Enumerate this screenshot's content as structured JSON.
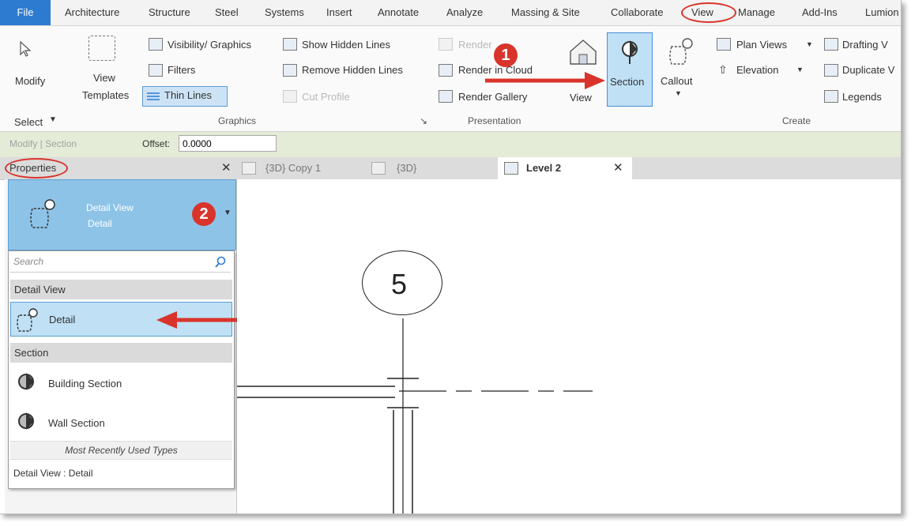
{
  "menu": {
    "tabs": [
      "File",
      "Architecture",
      "Structure",
      "Steel",
      "Systems",
      "Insert",
      "Annotate",
      "Analyze",
      "Massing & Site",
      "Collaborate",
      "View",
      "Manage",
      "Add-Ins",
      "Lumion"
    ]
  },
  "ribbon": {
    "modify": "Modify",
    "select": "Select",
    "view_templates_1": "View",
    "view_templates_2": "Templates",
    "visibility_graphics": "Visibility/ Graphics",
    "filters": "Filters",
    "thin_lines": "Thin Lines",
    "show_hidden_lines": "Show Hidden Lines",
    "remove_hidden_lines": "Remove Hidden Lines",
    "cut_profile": "Cut Profile",
    "render": "Render",
    "render_in_cloud": "Render in Cloud",
    "render_gallery": "Render Gallery",
    "view_3d": "View",
    "section": "Section",
    "callout": "Callout",
    "plan_views": "Plan Views",
    "elevation": "Elevation",
    "drafting_view": "Drafting V",
    "duplicate_view": "Duplicate V",
    "legends": "Legends",
    "groups": {
      "graphics": "Graphics",
      "presentation": "Presentation",
      "create": "Create"
    }
  },
  "options_bar": {
    "context": "Modify | Section",
    "offset_label": "Offset:",
    "offset_value": "0.0000"
  },
  "properties": {
    "title": "Properties",
    "type_family": "Detail View",
    "type_name": "Detail"
  },
  "view_tabs": [
    "{3D} Copy 1",
    "{3D}",
    "Level 2"
  ],
  "type_selector": {
    "search_placeholder": "Search",
    "group_detail": "Detail View",
    "item_detail": "Detail",
    "group_section": "Section",
    "item_building_section": "Building Section",
    "item_wall_section": "Wall Section",
    "mru_header": "Most Recently Used Types",
    "mru_item": "Detail View : Detail"
  },
  "callouts": {
    "step1": "1",
    "step2": "2"
  },
  "canvas": {
    "grid_label": "5"
  },
  "colors": {
    "accent": "#2d7bd1",
    "highlight": "#bfe0f5",
    "annotation_red": "#d9342b",
    "options_bar": "#e4ebd6"
  }
}
